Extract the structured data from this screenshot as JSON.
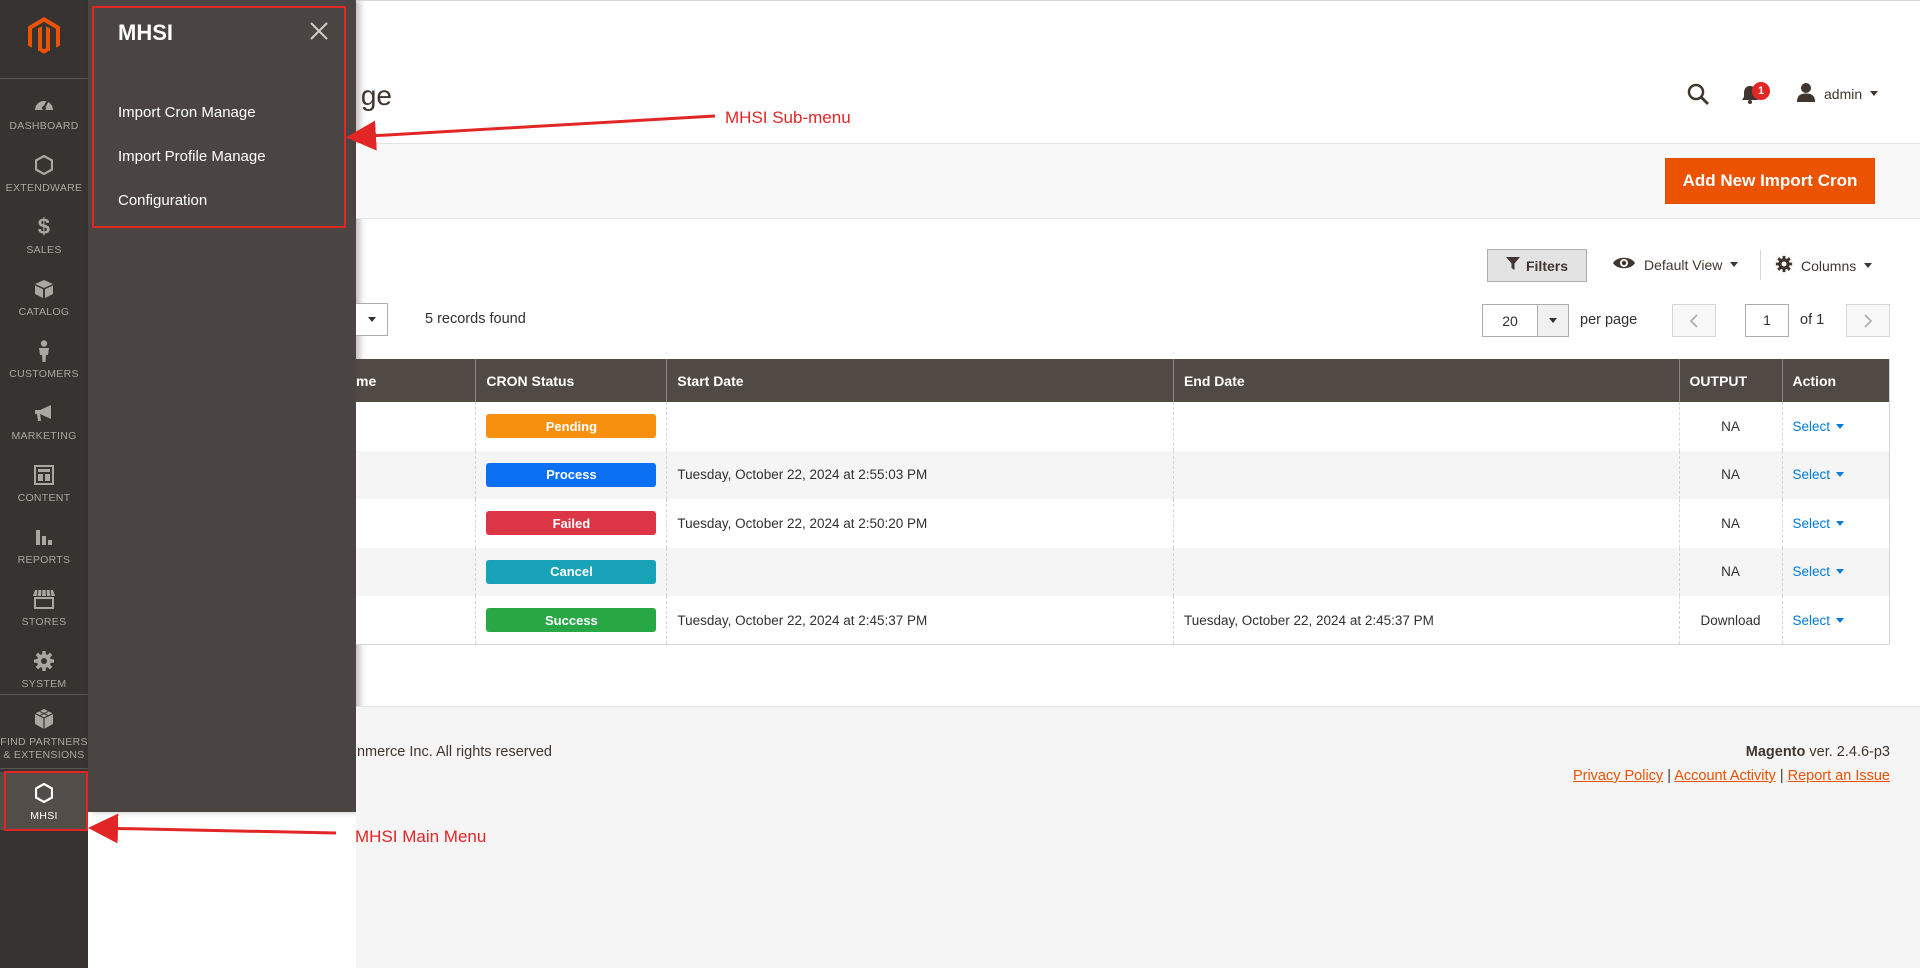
{
  "nav": {
    "items": [
      {
        "label": "DASHBOARD",
        "icon": "dashboard-icon"
      },
      {
        "label": "EXTENDWARE",
        "icon": "hexagon-icon"
      },
      {
        "label": "SALES",
        "icon": "dollar-icon"
      },
      {
        "label": "CATALOG",
        "icon": "box-icon"
      },
      {
        "label": "CUSTOMERS",
        "icon": "person-icon"
      },
      {
        "label": "MARKETING",
        "icon": "megaphone-icon"
      },
      {
        "label": "CONTENT",
        "icon": "layout-icon"
      },
      {
        "label": "REPORTS",
        "icon": "bar-chart-icon"
      },
      {
        "label": "STORES",
        "icon": "storefront-icon"
      },
      {
        "label": "SYSTEM",
        "icon": "gear-icon"
      },
      {
        "label": "FIND PARTNERS",
        "label2": "& EXTENSIONS",
        "icon": "cubes-icon"
      },
      {
        "label": "MHSI",
        "icon": "hexagon-icon"
      }
    ]
  },
  "submenu": {
    "title": "MHSI",
    "links": [
      "Import Cron Manage",
      "Import Profile Manage",
      "Configuration"
    ]
  },
  "header": {
    "page_title_fragment": "ge",
    "notification_count": "1",
    "user": "admin"
  },
  "action_bar": {
    "add_button": "Add New Import Cron"
  },
  "grid_controls": {
    "filters": "Filters",
    "view": "Default View",
    "columns": "Columns",
    "records_found": "5 records found",
    "per_page_value": "20",
    "per_page_label": "per page",
    "current_page": "1",
    "of_pages": "of 1"
  },
  "table": {
    "columns": [
      "me",
      "CRON Status",
      "Start Date",
      "End Date",
      "OUTPUT",
      "Action"
    ],
    "rows": [
      {
        "status": "Pending",
        "status_color": "#f7900f",
        "start": "",
        "end": "",
        "output": "NA",
        "action": "Select"
      },
      {
        "status": "Process",
        "status_color": "#0a6ff0",
        "start": "Tuesday, October 22, 2024 at 2:55:03 PM",
        "end": "",
        "output": "NA",
        "action": "Select"
      },
      {
        "status": "Failed",
        "status_color": "#dc3545",
        "start": "Tuesday, October 22, 2024 at 2:50:20 PM",
        "end": "",
        "output": "NA",
        "action": "Select"
      },
      {
        "status": "Cancel",
        "status_color": "#17a2b8",
        "start": "",
        "end": "",
        "output": "NA",
        "action": "Select"
      },
      {
        "status": "Success",
        "status_color": "#28a745",
        "start": "Tuesday, October 22, 2024 at 2:45:37 PM",
        "end": "Tuesday, October 22, 2024 at 2:45:37 PM",
        "output": "Download",
        "action": "Select"
      }
    ]
  },
  "footer": {
    "copyright_fragment": "nmerce Inc. All rights reserved.",
    "magento": "Magento",
    "version": " ver. 2.4.6-p3",
    "links": [
      "Privacy Policy",
      "Account Activity",
      "Report an Issue"
    ],
    "sep": "|"
  },
  "annotations": {
    "submenu_label": "MHSI Sub-menu",
    "mainmenu_label": "MHSI Main Menu"
  },
  "colors": {
    "nav_bg": "#373330",
    "submenu_bg": "#4a4542",
    "accent": "#eb5202",
    "table_header": "#514943",
    "annotation_red": "#e22626"
  }
}
